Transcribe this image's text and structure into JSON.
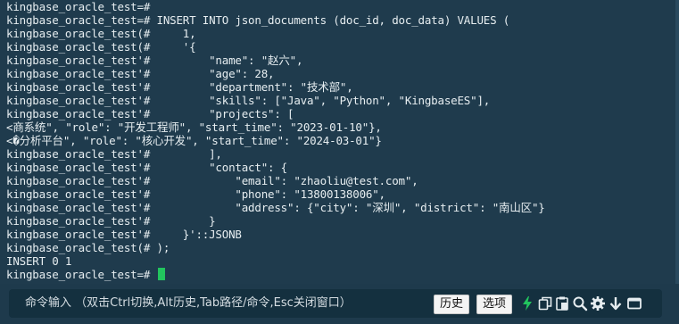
{
  "terminal": {
    "lines": [
      "kingbase_oracle_test=#",
      "kingbase_oracle_test=# INSERT INTO json_documents (doc_id, doc_data) VALUES (",
      "kingbase_oracle_test(#     1,",
      "kingbase_oracle_test(#     '{",
      "kingbase_oracle_test'#         \"name\": \"赵六\",",
      "kingbase_oracle_test'#         \"age\": 28,",
      "kingbase_oracle_test'#         \"department\": \"技术部\",",
      "kingbase_oracle_test'#         \"skills\": [\"Java\", \"Python\", \"KingbaseES\"],",
      "kingbase_oracle_test'#         \"projects\": [",
      "<商系统\", \"role\": \"开发工程师\", \"start_time\": \"2023-01-10\"},",
      "<�分析平台\", \"role\": \"核心开发\", \"start_time\": \"2024-03-01\"}",
      "kingbase_oracle_test'#         ],",
      "kingbase_oracle_test'#         \"contact\": {",
      "kingbase_oracle_test'#             \"email\": \"zhaoliu@test.com\",",
      "kingbase_oracle_test'#             \"phone\": \"13800138006\",",
      "kingbase_oracle_test'#             \"address\": {\"city\": \"深圳\", \"district\": \"南山区\"}",
      "kingbase_oracle_test'#         }",
      "kingbase_oracle_test'#     }'::JSONB",
      "kingbase_oracle_test(# );",
      "INSERT 0 1",
      "kingbase_oracle_test=# "
    ]
  },
  "command_bar": {
    "placeholder": "命令输入 （双击Ctrl切换,Alt历史,Tab路径/命令,Esc关闭窗口）",
    "history_label": "历史",
    "options_label": "选项"
  },
  "colors": {
    "terminal_bg": "#1f3b4d",
    "text": "#e6edf0",
    "cursor": "#22c55e",
    "bolt_icon": "#22c55e",
    "icon": "#e6edf0"
  },
  "icons": [
    "bolt-icon",
    "copy-icon",
    "paste-icon",
    "search-icon",
    "gear-icon",
    "download-icon",
    "window-icon"
  ]
}
